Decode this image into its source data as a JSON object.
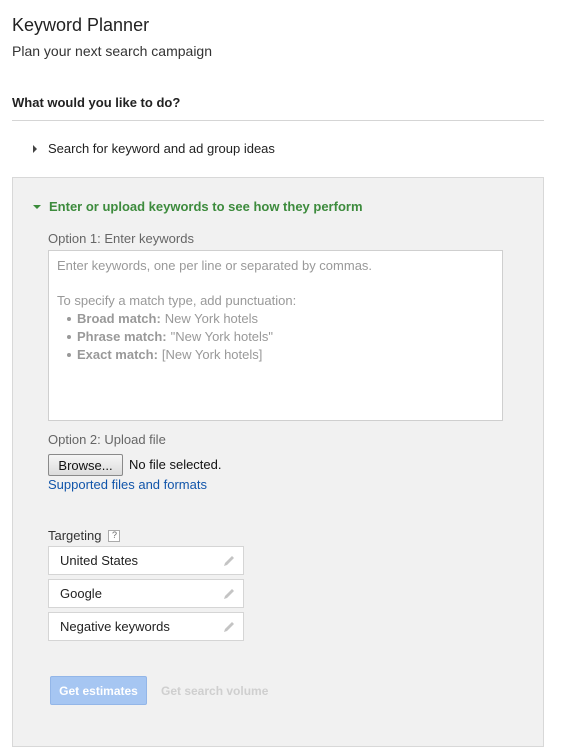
{
  "header": {
    "title": "Keyword Planner",
    "subtitle": "Plan your next search campaign"
  },
  "question": "What would you like to do?",
  "options": {
    "collapsed_label": "Search for keyword and ad group ideas",
    "expanded_label": "Enter or upload keywords to see how they perform"
  },
  "option1": {
    "label": "Option 1: Enter keywords",
    "placeholder_line1": "Enter keywords, one per line or separated by commas.",
    "placeholder_line2": "To specify a match type, add punctuation:",
    "match_types": [
      {
        "name": "Broad match:",
        "example": "New York hotels"
      },
      {
        "name": "Phrase match:",
        "example": "\"New York hotels\""
      },
      {
        "name": "Exact match:",
        "example": "[New York hotels]"
      }
    ]
  },
  "option2": {
    "label": "Option 2: Upload file",
    "browse_label": "Browse...",
    "file_status": "No file selected.",
    "supported_link": "Supported files and formats"
  },
  "targeting": {
    "label": "Targeting",
    "help": "?",
    "items": [
      "United States",
      "Google",
      "Negative keywords"
    ]
  },
  "actions": {
    "get_estimates": "Get estimates",
    "get_search_volume": "Get search volume"
  },
  "icons": {
    "collapsed": "triangle-right-icon",
    "expanded": "triangle-down-icon",
    "edit": "pencil-icon",
    "help": "help-icon"
  },
  "colors": {
    "accent_green": "#3d8b3d",
    "link_blue": "#1155aa",
    "primary_disabled": "#a6c6f2"
  }
}
